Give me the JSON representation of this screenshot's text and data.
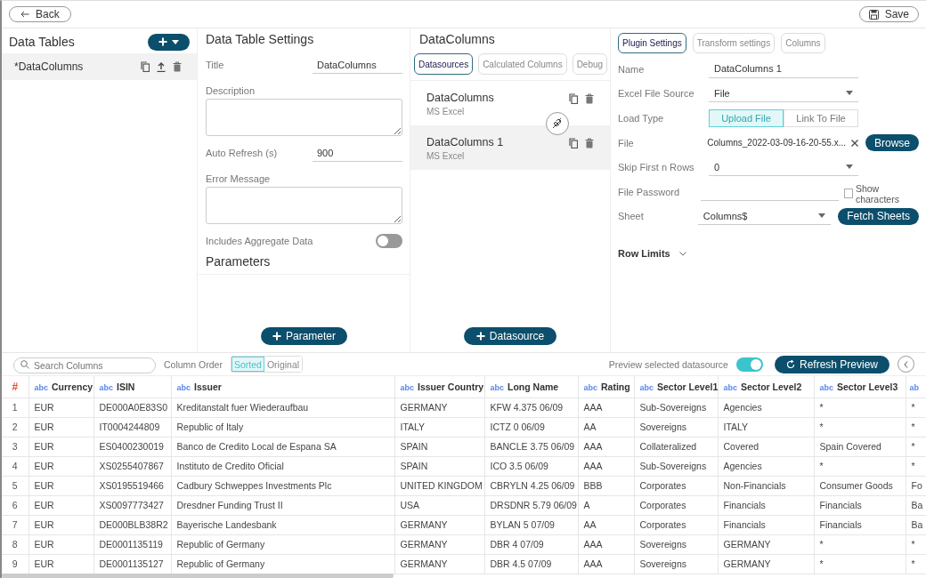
{
  "toolbar": {
    "back": "Back",
    "save": "Save"
  },
  "data_tables": {
    "title": "Data Tables",
    "items": [
      {
        "label": "*DataColumns",
        "selected": true
      }
    ]
  },
  "settings": {
    "title": "Data Table Settings",
    "fields": [
      {
        "kind": "input",
        "label": "Title",
        "value": "DataColumns"
      },
      {
        "kind": "textarea",
        "label": "Description"
      },
      {
        "kind": "input",
        "label": "Auto Refresh (s)",
        "value": "900"
      },
      {
        "kind": "textarea",
        "label": "Error Message"
      },
      {
        "kind": "toggle",
        "label": "Includes Aggregate Data",
        "on": false
      }
    ],
    "parameters_title": "Parameters",
    "add_button": "Parameter"
  },
  "datacolumns": {
    "title": "DataColumns",
    "tabs": [
      {
        "label": "Datasources",
        "selected": true
      },
      {
        "label": "Calculated Columns",
        "selected": false
      },
      {
        "label": "Debug",
        "selected": false
      }
    ],
    "items": [
      {
        "name": "DataColumns",
        "type": "MS Excel",
        "selected": false
      },
      {
        "name": "DataColumns 1",
        "type": "MS Excel",
        "selected": true
      }
    ],
    "add_button": "Datasource"
  },
  "plugin": {
    "tabs": [
      {
        "label": "Plugin Settings",
        "selected": true
      },
      {
        "label": "Transform settings",
        "selected": false
      },
      {
        "label": "Columns",
        "selected": false
      }
    ],
    "fields": [
      {
        "kind": "input",
        "label": "Name",
        "value": "DataColumns 1"
      },
      {
        "kind": "select",
        "label": "Excel File Source",
        "value": "File"
      },
      {
        "kind": "segmented",
        "label": "Load Type",
        "options": [
          {
            "label": "Upload File",
            "selected": true
          },
          {
            "label": "Link To File",
            "selected": false
          }
        ]
      },
      {
        "kind": "file",
        "label": "File",
        "value": "Columns_2022-03-09-16-20-55.x...",
        "button": "Browse"
      },
      {
        "kind": "select",
        "label": "Skip First n Rows",
        "value": "0"
      },
      {
        "kind": "password",
        "label": "File Password",
        "checkbox": {
          "label": "Show characters",
          "checked": false
        }
      },
      {
        "kind": "select",
        "label": "Sheet",
        "value": "Columns$",
        "button": "Fetch Sheets"
      }
    ],
    "row_limits": "Row Limits"
  },
  "preview": {
    "search": {
      "placeholder": "Search Columns"
    },
    "column_order": {
      "label": "Column Order",
      "options": [
        {
          "label": "Sorted",
          "selected": true
        },
        {
          "label": "Original",
          "selected": false
        }
      ]
    },
    "preview_toggle": {
      "label": "Preview selected datasource",
      "on": true
    },
    "refresh_button": "Refresh Preview"
  },
  "table": {
    "columns": [
      {
        "kind": "index",
        "name": "#"
      },
      {
        "type": "abc",
        "name": "Currency"
      },
      {
        "type": "abc",
        "name": "ISIN"
      },
      {
        "type": "abc",
        "name": "Issuer"
      },
      {
        "type": "abc",
        "name": "Issuer Country"
      },
      {
        "type": "abc",
        "name": "Long Name"
      },
      {
        "type": "abc",
        "name": "Rating"
      },
      {
        "type": "abc",
        "name": "Sector Level1"
      },
      {
        "type": "abc",
        "name": "Sector Level2"
      },
      {
        "type": "abc",
        "name": "Sector Level3"
      },
      {
        "kind": "partial",
        "type": "ab"
      }
    ],
    "rows": [
      [
        "1",
        "EUR",
        "DE000A0E83S0",
        "Kreditanstalt fuer Wiederaufbau",
        "GERMANY",
        "KFW 4.375 06/09",
        "AAA",
        "Sub-Sovereigns",
        "Agencies",
        "*",
        "*"
      ],
      [
        "2",
        "EUR",
        "IT0004244809",
        "Republic of Italy",
        "ITALY",
        "ICTZ 0 06/09",
        "AA",
        "Sovereigns",
        "ITALY",
        "*",
        "*"
      ],
      [
        "3",
        "EUR",
        "ES0400230019",
        "Banco de Credito Local de Espana SA",
        "SPAIN",
        "BANCLE 3.75 06/09",
        "AAA",
        "Collateralized",
        "Covered",
        "Spain Covered",
        "*"
      ],
      [
        "4",
        "EUR",
        "XS0255407867",
        "Instituto de Credito Oficial",
        "SPAIN",
        "ICO 3.5 06/09",
        "AAA",
        "Sub-Sovereigns",
        "Agencies",
        "*",
        "*"
      ],
      [
        "5",
        "EUR",
        "XS0195519466",
        "Cadbury Schweppes Investments Plc",
        "UNITED KINGDOM",
        "CBRYLN 4.25 06/09",
        "BBB",
        "Corporates",
        "Non-Financials",
        "Consumer Goods",
        "Fo"
      ],
      [
        "6",
        "EUR",
        "XS0097773427",
        "Dresdner Funding Trust II",
        "USA",
        "DRSDNR 5.79 06/09",
        "A",
        "Corporates",
        "Financials",
        "Financials",
        "Ba"
      ],
      [
        "7",
        "EUR",
        "DE000BLB38R2",
        "Bayerische Landesbank",
        "GERMANY",
        "BYLAN 5 07/09",
        "AA",
        "Corporates",
        "Financials",
        "Financials",
        "Ba"
      ],
      [
        "8",
        "EUR",
        "DE0001135119",
        "Republic of Germany",
        "GERMANY",
        "DBR 4 07/09",
        "AAA",
        "Sovereigns",
        "GERMANY",
        "*",
        "*"
      ],
      [
        "9",
        "EUR",
        "DE0001135127",
        "Republic of Germany",
        "GERMANY",
        "DBR 4.5 07/09",
        "AAA",
        "Sovereigns",
        "GERMANY",
        "*",
        "*"
      ]
    ]
  }
}
